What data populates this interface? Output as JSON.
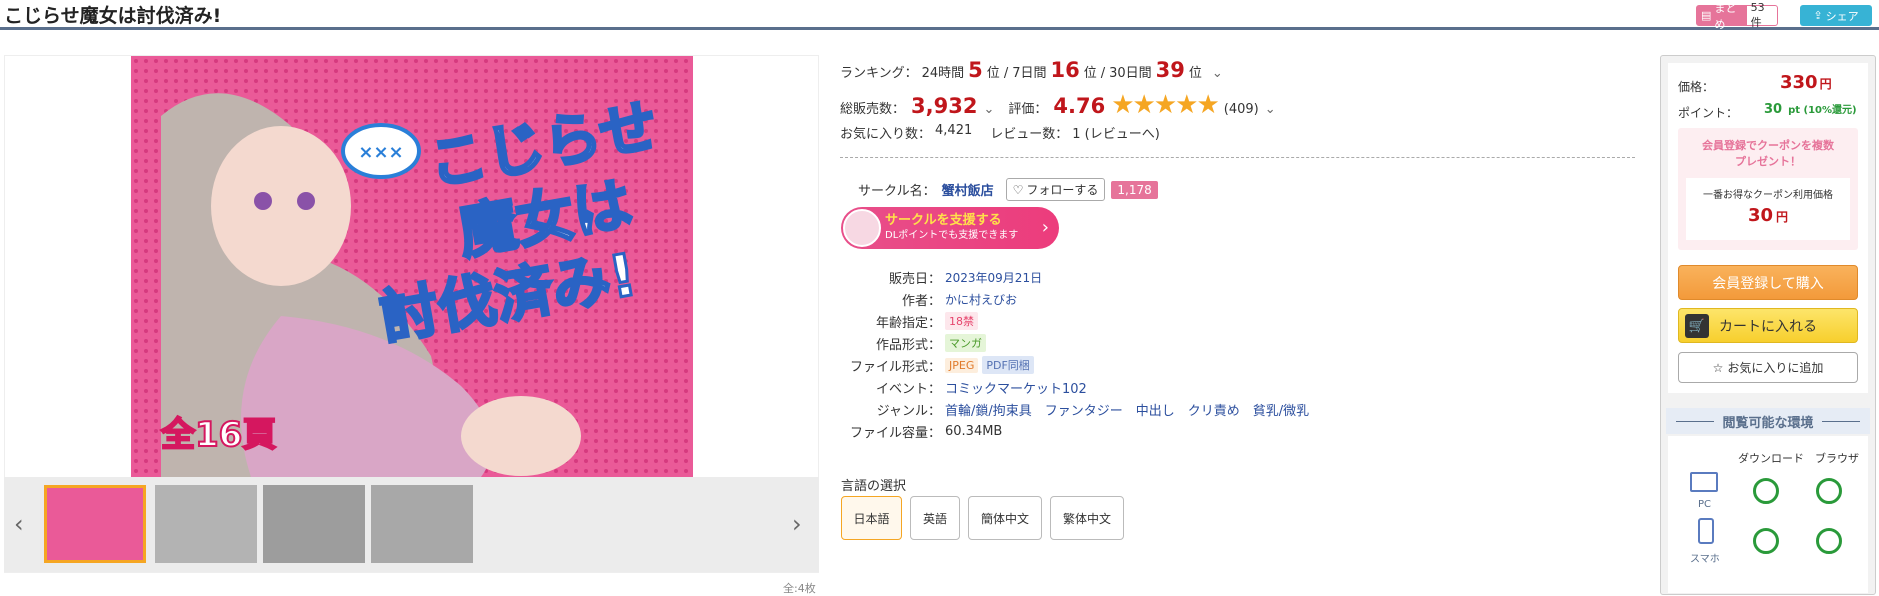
{
  "header": {
    "title": "こじらせ魔女は討伐済み!",
    "matome_label": "まとめ",
    "matome_count": "53件",
    "share_label": "シェア"
  },
  "cover": {
    "main_text": "こじらせ魔女は討伐済み!",
    "badge": "全16頁"
  },
  "gallery": {
    "total": "全:4枚"
  },
  "ranking": {
    "label": "ランキング：",
    "p24_label": "24時間",
    "p24": "5",
    "p7_label": "7日間",
    "p7": "16",
    "p30_label": "30日間",
    "p30": "39",
    "unit": "位",
    "sep": "/"
  },
  "sales": {
    "label": "総販売数：",
    "value": "3,932",
    "rating_label": "評価：",
    "rating": "4.76",
    "stars": "★★★★★",
    "review_count": "(409)"
  },
  "favs": {
    "label": "お気に入り数：",
    "value": "4,421",
    "review_label": "レビュー数：",
    "review_value": "1 (レビューへ)"
  },
  "circle": {
    "label": "サークル名：",
    "name": "蟹村飯店",
    "follow": "フォローする",
    "followers": "1,178",
    "support_title": "サークルを支援する",
    "support_sub": "DLポイントでも支援できます"
  },
  "details": [
    {
      "label": "販売日：",
      "value": "2023年09月21日"
    },
    {
      "label": "作者：",
      "value": "かに村えびお"
    },
    {
      "label": "年齢指定：",
      "value": "18禁"
    },
    {
      "label": "作品形式：",
      "value": "マンガ"
    },
    {
      "label": "ファイル形式：",
      "value": "JPEG",
      "value2": "PDF同梱"
    },
    {
      "label": "イベント：",
      "value": "コミックマーケット102"
    },
    {
      "label": "ジャンル：",
      "value": "首輪/鎖/拘束具　ファンタジー　中出し　クリ責め　貧乳/微乳"
    },
    {
      "label": "ファイル容量：",
      "value": "60.34MB"
    }
  ],
  "language": {
    "label": "言語の選択",
    "options": [
      "日本語",
      "英語",
      "簡体中文",
      "繁体中文"
    ]
  },
  "price": {
    "label": "価格：",
    "value": "330",
    "unit": "円",
    "point_label": "ポイント：",
    "point_value": "30",
    "point_unit": "pt (10%還元)"
  },
  "coupon": {
    "title1": "会員登録でクーポンを複数",
    "title2": "プレゼント！",
    "sub": "一番お得なクーポン利用価格",
    "price": "30",
    "unit": "円"
  },
  "buttons": {
    "register": "会員登録して購入",
    "cart": "カートに入れる",
    "fav": "お気に入りに追加"
  },
  "env": {
    "title": "閲覧可能な環境",
    "col1": "ダウンロード",
    "col2": "ブラウザ",
    "pc": "PC",
    "phone": "スマホ"
  },
  "colors": {
    "accent_red": "#c0161b",
    "brand_orange": "#f39a3b",
    "link_blue": "#2c4f9e",
    "pink": "#e6749a"
  }
}
